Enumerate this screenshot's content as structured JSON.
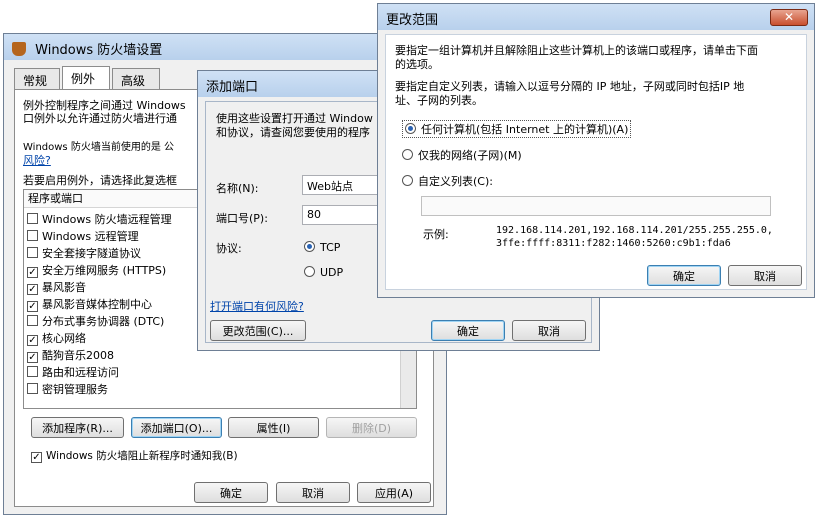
{
  "firewall": {
    "title": "Windows 防火墙设置",
    "tabs": [
      "常规",
      "例外",
      "高级"
    ],
    "intro_line1": "例外控制程序之间通过 Windows",
    "intro_line2": "口例外以允许通过防火墙进行通",
    "current_line": "Windows 防火墙当前使用的是 公",
    "risk_link": "风险?",
    "enable_line": "若要启用例外，请选择此复选框",
    "list_header": "程序或端口",
    "items": [
      {
        "label": "Windows 防火墙远程管理",
        "checked": false
      },
      {
        "label": "Windows 远程管理",
        "checked": false
      },
      {
        "label": "安全套接字隧道协议",
        "checked": false
      },
      {
        "label": "安全万维网服务 (HTTPS)",
        "checked": true
      },
      {
        "label": "暴风影音",
        "checked": true
      },
      {
        "label": "暴风影音媒体控制中心",
        "checked": true
      },
      {
        "label": "分布式事务协调器 (DTC)",
        "checked": false
      },
      {
        "label": "核心网络",
        "checked": true
      },
      {
        "label": "酷狗音乐2008",
        "checked": true
      },
      {
        "label": "路由和远程访问",
        "checked": false
      },
      {
        "label": "密钥管理服务",
        "checked": false
      }
    ],
    "add_program": "添加程序(R)...",
    "add_port": "添加端口(O)...",
    "properties": "属性(I)",
    "delete": "删除(D)",
    "notify_label": "Windows 防火墙阻止新程序时通知我(B)",
    "ok": "确定",
    "cancel": "取消",
    "apply": "应用(A)"
  },
  "add_port": {
    "title": "添加端口",
    "desc_line1": "使用这些设置打开通过 Window",
    "desc_line2": "和协议，请查阅您要使用的程序",
    "name_label": "名称(N):",
    "name_value": "Web站点",
    "port_label": "端口号(P):",
    "port_value": "80",
    "protocol_label": "协议:",
    "tcp": "TCP",
    "udp": "UDP",
    "risk_link": "打开端口有何风险?",
    "change_scope": "更改范围(C)...",
    "ok": "确定",
    "cancel": "取消"
  },
  "scope": {
    "title": "更改范围",
    "desc1_line1": "要指定一组计算机并且解除阻止这些计算机上的该端口或程序，请单击下面",
    "desc1_line2": "的选项。",
    "desc2_line1": "要指定自定义列表，请输入以逗号分隔的 IP 地址，子网或同时包括IP 地",
    "desc2_line2": "址、子网的列表。",
    "opt_any": "任何计算机(包括 Internet 上的计算机)(A)",
    "opt_subnet": "仅我的网络(子网)(M)",
    "opt_custom": "自定义列表(C):",
    "custom_value": "",
    "example_label": "示例:",
    "example_line1": "192.168.114.201,192.168.114.201/255.255.255.0,",
    "example_line2": "3ffe:ffff:8311:f282:1460:5260:c9b1:fda6",
    "ok": "确定",
    "cancel": "取消"
  }
}
